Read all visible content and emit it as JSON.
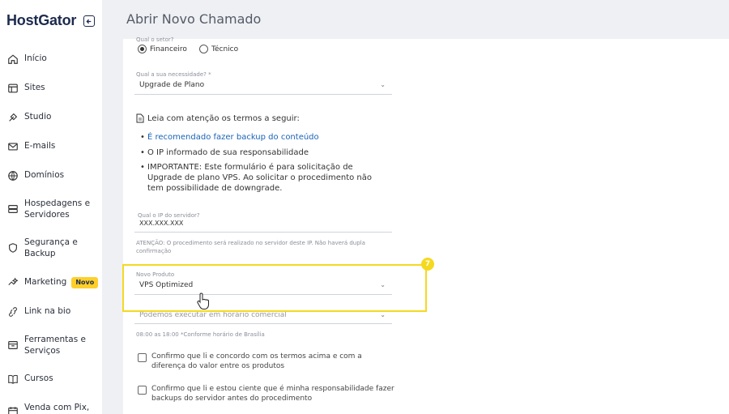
{
  "sidebar": {
    "logo": "HostGator",
    "items": [
      {
        "label": "Início",
        "icon": "home-icon"
      },
      {
        "label": "Sites",
        "icon": "sites-icon"
      },
      {
        "label": "Studio",
        "icon": "studio-icon"
      },
      {
        "label": "E-mails",
        "icon": "mail-icon"
      },
      {
        "label": "Domínios",
        "icon": "globe-icon"
      },
      {
        "label": "Hospedagens e Servidores",
        "icon": "server-icon"
      },
      {
        "label": "Segurança e Backup",
        "icon": "shield-icon"
      },
      {
        "label": "Marketing",
        "icon": "marketing-icon",
        "badge": "Novo"
      },
      {
        "label": "Link na bio",
        "icon": "link-icon"
      },
      {
        "label": "Ferramentas e Serviços",
        "icon": "tools-icon"
      },
      {
        "label": "Cursos",
        "icon": "book-icon"
      },
      {
        "label": "Venda com Pix,",
        "icon": "calendar-icon"
      }
    ]
  },
  "header": {
    "title": "Abrir Novo Chamado"
  },
  "form": {
    "sector_label": "Qual o setor?",
    "sector_options": [
      "Financeiro",
      "Técnico"
    ],
    "sector_selected": "Financeiro",
    "need_label": "Qual a sua necessidade? *",
    "need_value": "Upgrade de Plano",
    "terms_title": "Leia com atenção os termos a seguir:",
    "terms": [
      "É recomendado fazer backup do conteúdo",
      "O IP informado de sua responsabilidade",
      "IMPORTANTE: Este formulário é para solicitação de Upgrade de plano VPS. Ao solicitar o procedimento não tem possibilidade de downgrade."
    ],
    "ip_label": "Qual o IP do servidor?",
    "ip_value": "XXX.XXX.XXX",
    "ip_note": "ATENÇÃO: O procedimento será realizado no servidor deste IP. Não haverá dupla confirmação",
    "product_label": "Novo Produto",
    "product_value": "VPS Optimized",
    "schedule_value": "Podemos executar em horário comercial",
    "schedule_note": "08:00 as 18:00 *Conforme horário de Brasília",
    "check1": "Confirmo que li e concordo com os termos acima e com a diferença do valor entre os produtos",
    "check2": "Confirmo que li e estou ciente que é minha responsabilidade fazer backups do servidor antes do procedimento"
  },
  "step": {
    "number": "7"
  },
  "colors": {
    "highlight": "#f5d91f",
    "link": "#1a63b8",
    "badge": "#ffcf2a",
    "brand": "#1c2a4e"
  }
}
